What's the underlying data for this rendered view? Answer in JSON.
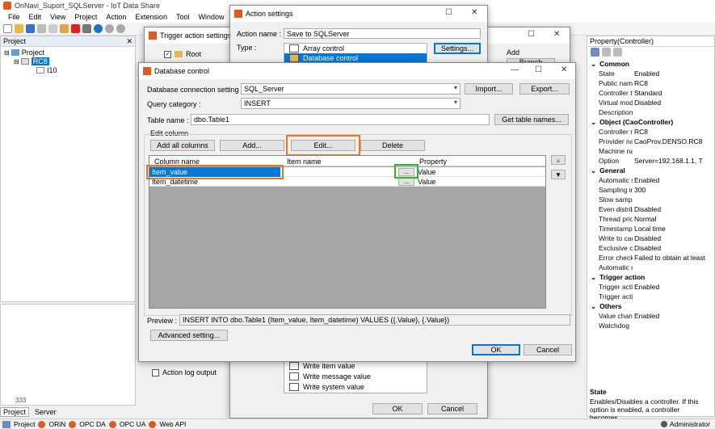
{
  "app": {
    "title": "OnNavi_Suport_SQLServer - IoT Data Share",
    "menu": [
      "File",
      "Edit",
      "View",
      "Project",
      "Action",
      "Extension",
      "Tool",
      "Window"
    ]
  },
  "project_panel": {
    "header": "Project",
    "tree": [
      "Project",
      "RC8",
      "I10"
    ],
    "tabs": [
      "Project",
      "Server"
    ],
    "action_log_label": "Action log output",
    "log_partial": "333"
  },
  "status_bar": {
    "items": [
      "Project",
      "ORiN",
      "OPC DA",
      "OPC UA",
      "Web API"
    ],
    "user": "Administrator"
  },
  "trigger_dialog": {
    "title": "Trigger action settings",
    "root": "Root",
    "add_label": "Add",
    "branch_label": "Branch"
  },
  "action_settings": {
    "title": "Action settings",
    "name_label": "Action name :",
    "name_value": "Save to SQLServer",
    "type_label": "Type :",
    "type_items": [
      "Array control",
      "Database control"
    ],
    "settings_button": "Settings...",
    "lower_items": [
      "Write item value",
      "Write message value",
      "Write system value"
    ],
    "ok": "OK",
    "cancel": "Cancel"
  },
  "db_control": {
    "title": "Database control",
    "conn_label": "Database connection setting :",
    "conn_value": "SQL_Server",
    "import_button": "Import...",
    "export_button": "Export...",
    "query_label": "Query category :",
    "query_value": "INSERT",
    "table_label": "Table name :",
    "table_value": "dbo.Table1",
    "get_table_button": "Get table names...",
    "edit_column_label": "Edit column",
    "add_all_button": "Add all columns",
    "add_button": "Add...",
    "edit_button": "Edit...",
    "delete_button": "Delete",
    "columns": [
      "Column name",
      "Item name",
      "Property"
    ],
    "rows": [
      {
        "column": "Item_value",
        "item": "",
        "ellipsis": "...",
        "property": "Value"
      },
      {
        "column": "Item_datetime",
        "item": "",
        "ellipsis": "...",
        "property": "Value"
      }
    ],
    "preview_label": "Preview :",
    "preview_value": "INSERT INTO dbo.Table1 (Item_value, Item_datetime) VALUES ({.Value}, {.Value})",
    "advanced_button": "Advanced setting...",
    "ok": "OK",
    "cancel": "Cancel"
  },
  "property_panel": {
    "header": "Property(Controller)",
    "categories": [
      {
        "name": "Common",
        "rows": [
          [
            "State",
            "Enabled"
          ],
          [
            "Public name",
            "RC8"
          ],
          [
            "Controller type",
            "Standard"
          ],
          [
            "Virtual mode",
            "Disabled"
          ],
          [
            "Description",
            ""
          ]
        ]
      },
      {
        "name": "Object (CaoController)",
        "rows": [
          [
            "Controller name",
            "RC8"
          ],
          [
            "Provider name",
            "CaoProv.DENSO.RC8"
          ],
          [
            "Machine name",
            ""
          ],
          [
            "Option",
            "Server=192.168.1.1, T"
          ]
        ]
      },
      {
        "name": "General",
        "rows": [
          [
            "Automatic sampling",
            "Enabled"
          ],
          [
            "Sampling interval",
            "300"
          ],
          [
            "Slow sampling",
            ""
          ],
          [
            "Even distribution",
            "Disabled"
          ],
          [
            "Thread priority",
            "Normal"
          ],
          [
            "Timestamp",
            "Local time"
          ],
          [
            "Write to cache",
            "Disabled"
          ],
          [
            "Exclusive control",
            "Disabled"
          ],
          [
            "Error check",
            "Failed to obtain at least"
          ],
          [
            "Automatic recovery",
            ""
          ]
        ]
      },
      {
        "name": "Trigger action",
        "rows": [
          [
            "Trigger action",
            "Enabled"
          ],
          [
            "Trigger action",
            ""
          ]
        ]
      },
      {
        "name": "Others",
        "rows": [
          [
            "Value change log",
            "Enabled"
          ],
          [
            "Watchdog",
            ""
          ]
        ]
      }
    ],
    "desc_title": "State",
    "desc_text": "Enables/Disables a controller. If this option is enabled, a controller becomes..."
  },
  "highlight_colors": {
    "orange": "#e8761e",
    "green": "#2db52d",
    "selection": "#0078d7"
  }
}
